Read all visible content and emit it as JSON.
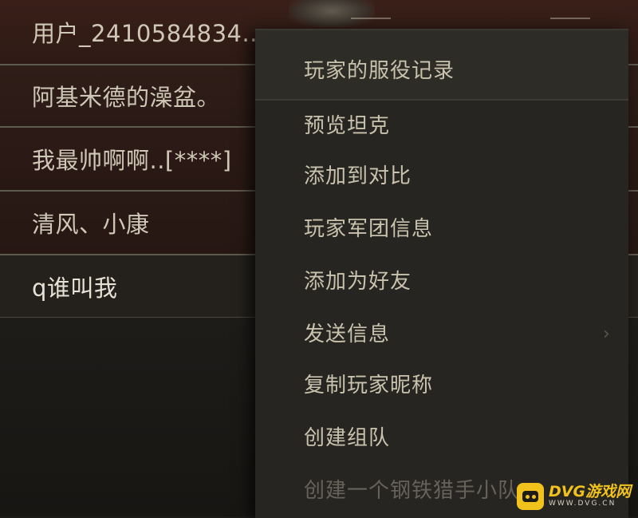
{
  "players": [
    "用户_2410584834..",
    "阿基米德的澡盆。",
    "我最帅啊啊..[****]",
    "清风、小康",
    "q谁叫我"
  ],
  "context_menu": {
    "items": [
      "玩家的服役记录",
      "预览坦克",
      "添加到对比",
      "玩家军团信息",
      "添加为好友",
      "发送信息",
      "复制玩家昵称",
      "创建组队",
      "创建一个钢铁猎手小队"
    ]
  },
  "watermark": {
    "title": "DVG游戏网",
    "url": "WWW.DVG.CN"
  },
  "colors": {
    "menu_bg": "#262521",
    "menu_text": "#c9c2ad",
    "watermark_accent": "#f1c21b"
  }
}
